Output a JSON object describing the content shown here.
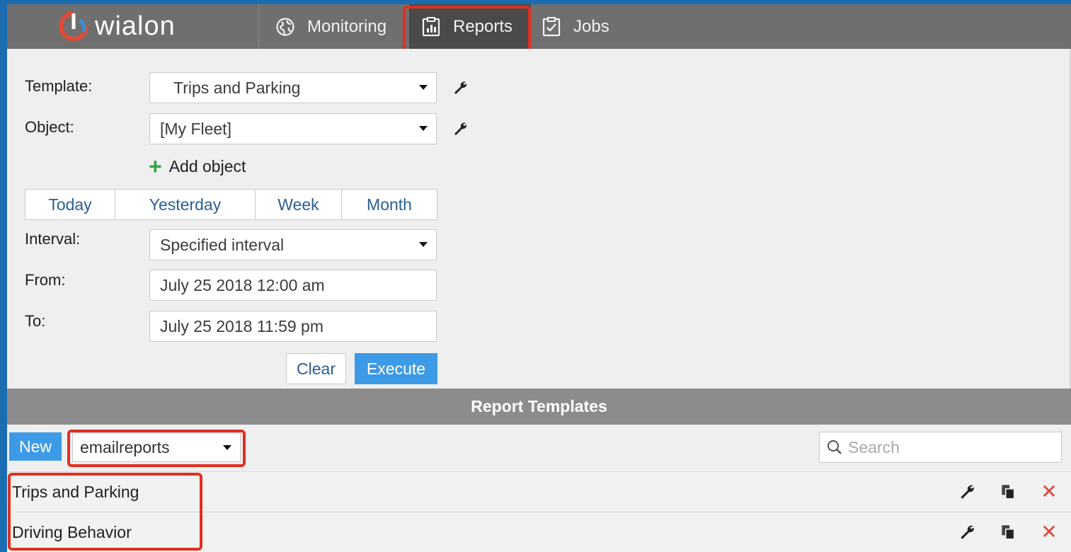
{
  "app": {
    "logo_text": "wialon"
  },
  "nav": {
    "items": [
      {
        "label": "Monitoring",
        "icon": "globe-icon"
      },
      {
        "label": "Reports",
        "icon": "report-icon",
        "active": true
      },
      {
        "label": "Jobs",
        "icon": "clipboard-check-icon"
      }
    ]
  },
  "form": {
    "template_label": "Template:",
    "template_value": "Trips and Parking",
    "object_label": "Object:",
    "object_value": "[My Fleet]",
    "add_object": "Add object",
    "periods": [
      "Today",
      "Yesterday",
      "Week",
      "Month"
    ],
    "interval_label": "Interval:",
    "interval_value": "Specified interval",
    "from_label": "From:",
    "from_value": "July 25 2018 12:00 am",
    "to_label": "To:",
    "to_value": "July 25 2018 11:59 pm",
    "clear_label": "Clear",
    "execute_label": "Execute"
  },
  "templates": {
    "header": "Report Templates",
    "new_label": "New",
    "resource_value": "emailreports",
    "search_placeholder": "Search",
    "rows": [
      {
        "name": "Trips and Parking"
      },
      {
        "name": "Driving Behavior"
      }
    ]
  },
  "colors": {
    "accent": "#3d9ae6",
    "highlight": "#e03020",
    "delete": "#e1453a",
    "add": "#2fa843"
  }
}
